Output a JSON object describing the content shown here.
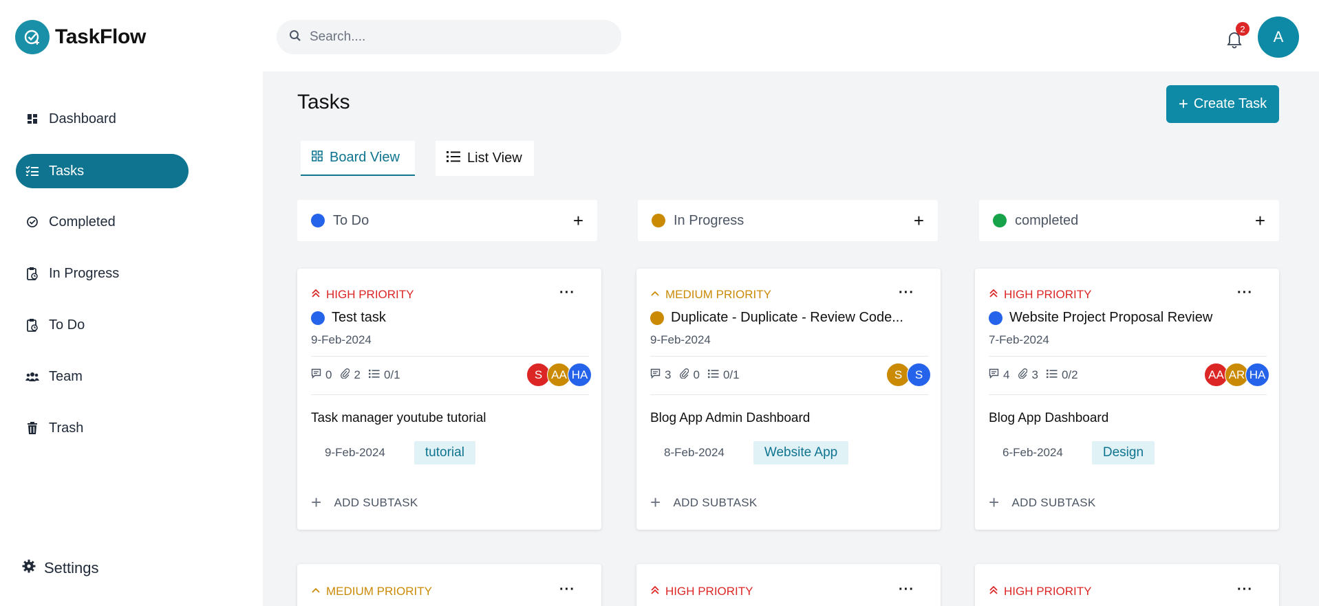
{
  "brand": {
    "name": "TaskFlow"
  },
  "sidebar": {
    "items": [
      {
        "label": "Dashboard",
        "icon": "dashboard-icon"
      },
      {
        "label": "Tasks",
        "icon": "tasks-icon",
        "active": true
      },
      {
        "label": "Completed",
        "icon": "check-circle-icon"
      },
      {
        "label": "In Progress",
        "icon": "clipboard-progress-icon"
      },
      {
        "label": "To Do",
        "icon": "clipboard-todo-icon"
      },
      {
        "label": "Team",
        "icon": "team-icon"
      },
      {
        "label": "Trash",
        "icon": "trash-icon"
      }
    ],
    "settings_label": "Settings"
  },
  "header": {
    "search_placeholder": "Search....",
    "notification_count": "2",
    "user_initial": "A"
  },
  "main": {
    "title": "Tasks",
    "create_label": "Create Task",
    "tabs": [
      {
        "label": "Board View",
        "active": true
      },
      {
        "label": "List View"
      }
    ],
    "columns": [
      {
        "label": "To Do",
        "color": "#2563eb"
      },
      {
        "label": "In Progress",
        "color": "#ca8a04"
      },
      {
        "label": "completed",
        "color": "#16a34a"
      }
    ],
    "cards": [
      {
        "priority": "HIGH PRIORITY",
        "priority_level": "high",
        "dot_color": "#2563eb",
        "title": "Test task",
        "date": "9-Feb-2024",
        "comments": "0",
        "attachments": "2",
        "subtasks": "0/1",
        "team": [
          {
            "initials": "S",
            "color": "red"
          },
          {
            "initials": "AA",
            "color": "yellow"
          },
          {
            "initials": "HA",
            "color": "blue"
          }
        ],
        "subtask_title": "Task manager youtube tutorial",
        "subtask_date": "9-Feb-2024",
        "tag": "tutorial",
        "add_subtask_label": "ADD SUBTASK"
      },
      {
        "priority": "MEDIUM PRIORITY",
        "priority_level": "medium",
        "dot_color": "#ca8a04",
        "title": "Duplicate - Duplicate - Review Code...",
        "date": "9-Feb-2024",
        "comments": "3",
        "attachments": "0",
        "subtasks": "0/1",
        "team": [
          {
            "initials": "S",
            "color": "yellow"
          },
          {
            "initials": "S",
            "color": "blue"
          }
        ],
        "subtask_title": "Blog App Admin Dashboard",
        "subtask_date": "8-Feb-2024",
        "tag": "Website App",
        "add_subtask_label": "ADD SUBTASK"
      },
      {
        "priority": "HIGH PRIORITY",
        "priority_level": "high",
        "dot_color": "#2563eb",
        "title": "Website Project Proposal Review",
        "date": "7-Feb-2024",
        "comments": "4",
        "attachments": "3",
        "subtasks": "0/2",
        "team": [
          {
            "initials": "AA",
            "color": "red"
          },
          {
            "initials": "AR",
            "color": "yellow"
          },
          {
            "initials": "HA",
            "color": "blue"
          }
        ],
        "subtask_title": "Blog App Dashboard",
        "subtask_date": "6-Feb-2024",
        "tag": "Design",
        "add_subtask_label": "ADD SUBTASK"
      }
    ],
    "peek_cards": [
      {
        "priority": "MEDIUM PRIORITY",
        "priority_level": "medium"
      },
      {
        "priority": "HIGH PRIORITY",
        "priority_level": "high"
      },
      {
        "priority": "HIGH PRIORITY",
        "priority_level": "high"
      }
    ]
  }
}
